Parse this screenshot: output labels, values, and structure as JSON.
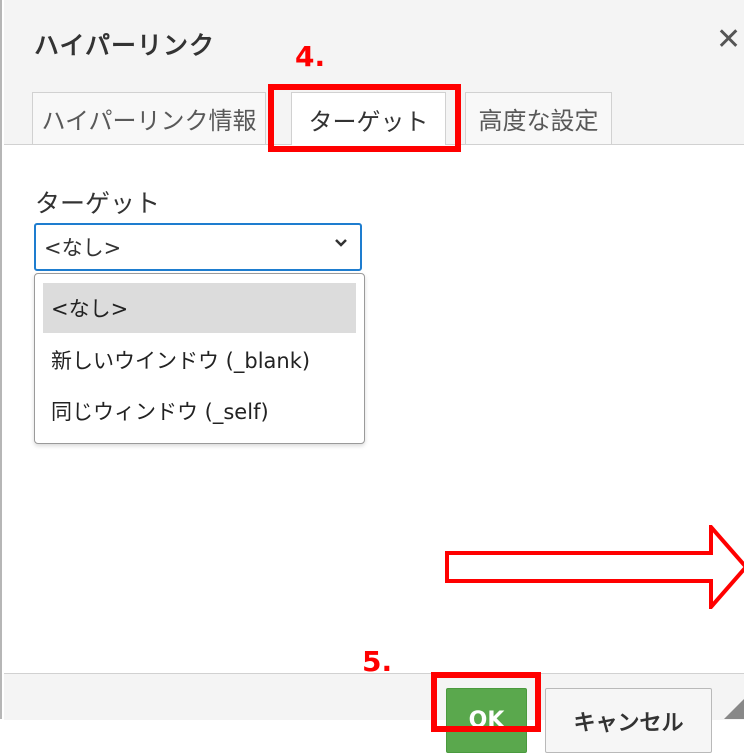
{
  "dialog": {
    "title": "ハイパーリンク",
    "close_glyph": "✕"
  },
  "tabs": [
    {
      "label": "ハイパーリンク情報"
    },
    {
      "label": "ターゲット"
    },
    {
      "label": "高度な設定"
    }
  ],
  "annotations": {
    "step4": "4.",
    "step5": "5.",
    "highlight_color": "#ff0000"
  },
  "target": {
    "label": "ターゲット",
    "selected": "<なし>",
    "options": [
      "<なし>",
      "新しいウインドウ (_blank)",
      "同じウィンドウ (_self)"
    ]
  },
  "footer": {
    "ok_label": "OK",
    "cancel_label": "キャンセル"
  },
  "icons": {
    "close": "close-icon",
    "dropdown": "chevron-down-icon",
    "resize": "resize-grip-icon",
    "arrow": "arrow-right-icon"
  },
  "colors": {
    "ok_button": "#5aa84d",
    "focus_border": "#1e7dcf"
  }
}
